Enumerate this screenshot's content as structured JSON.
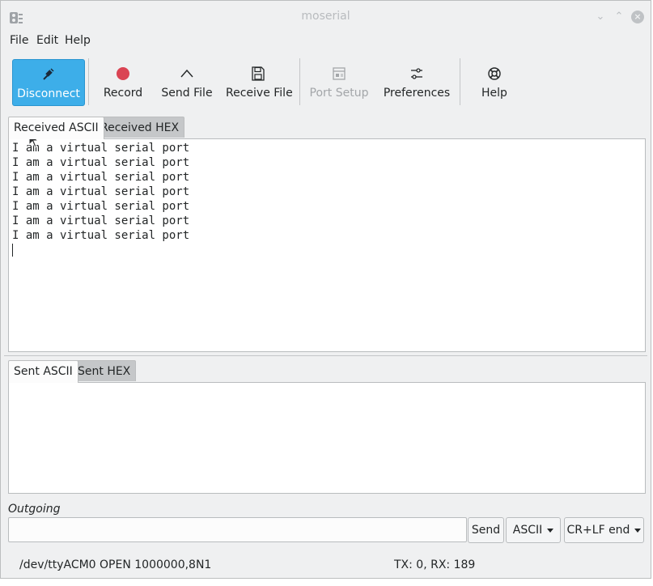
{
  "window": {
    "title": "moserial"
  },
  "menu": [
    "File",
    "Edit",
    "Help"
  ],
  "toolbar": {
    "disconnect": "Disconnect",
    "record": "Record",
    "send_file": "Send File",
    "receive_file": "Receive File",
    "port_setup": "Port Setup",
    "preferences": "Preferences",
    "help": "Help"
  },
  "received_tabs": [
    "Received ASCII",
    "Received HEX"
  ],
  "received_lines": [
    "I am a virtual serial port",
    "I am a virtual serial port",
    "I am a virtual serial port",
    "I am a virtual serial port",
    "I am a virtual serial port",
    "I am a virtual serial port",
    "I am a virtual serial port"
  ],
  "sent_tabs": [
    "Sent ASCII",
    "Sent HEX"
  ],
  "outgoing": {
    "label": "Outgoing",
    "value": "",
    "send": "Send",
    "format": "ASCII",
    "line_end": "CR+LF end"
  },
  "status": {
    "port": "/dev/ttyACM0 OPEN 1000000,8N1",
    "counts": "TX: 0, RX: 189"
  },
  "colors": {
    "accent": "#3daee9",
    "record": "#da4453"
  }
}
